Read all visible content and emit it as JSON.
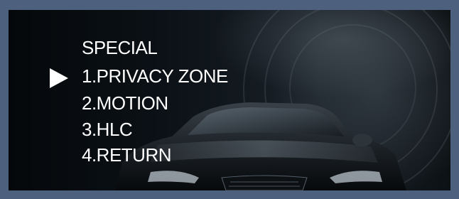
{
  "menu": {
    "title": "SPECIAL",
    "items": [
      {
        "label": "1.PRIVACY ZONE",
        "selected": true
      },
      {
        "label": "2.MOTION",
        "selected": false
      },
      {
        "label": "3.HLC",
        "selected": false
      },
      {
        "label": "4.RETURN",
        "selected": false
      }
    ],
    "cursor_icon": "triangle-right-icon"
  },
  "colors": {
    "frame": "#4d607e",
    "text": "#ffffff"
  }
}
